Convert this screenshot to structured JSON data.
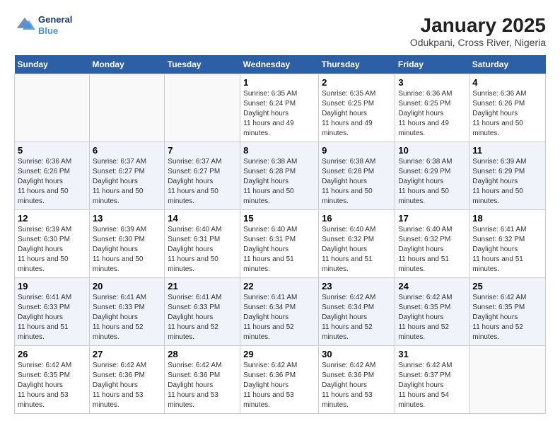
{
  "header": {
    "title": "January 2025",
    "subtitle": "Odukpani, Cross River, Nigeria",
    "logo_line1": "General",
    "logo_line2": "Blue"
  },
  "weekdays": [
    "Sunday",
    "Monday",
    "Tuesday",
    "Wednesday",
    "Thursday",
    "Friday",
    "Saturday"
  ],
  "weeks": [
    [
      {
        "day": "",
        "sunrise": "",
        "sunset": "",
        "daylight": ""
      },
      {
        "day": "",
        "sunrise": "",
        "sunset": "",
        "daylight": ""
      },
      {
        "day": "",
        "sunrise": "",
        "sunset": "",
        "daylight": ""
      },
      {
        "day": "1",
        "sunrise": "6:35 AM",
        "sunset": "6:24 PM",
        "daylight": "11 hours and 49 minutes."
      },
      {
        "day": "2",
        "sunrise": "6:35 AM",
        "sunset": "6:25 PM",
        "daylight": "11 hours and 49 minutes."
      },
      {
        "day": "3",
        "sunrise": "6:36 AM",
        "sunset": "6:25 PM",
        "daylight": "11 hours and 49 minutes."
      },
      {
        "day": "4",
        "sunrise": "6:36 AM",
        "sunset": "6:26 PM",
        "daylight": "11 hours and 50 minutes."
      }
    ],
    [
      {
        "day": "5",
        "sunrise": "6:36 AM",
        "sunset": "6:26 PM",
        "daylight": "11 hours and 50 minutes."
      },
      {
        "day": "6",
        "sunrise": "6:37 AM",
        "sunset": "6:27 PM",
        "daylight": "11 hours and 50 minutes."
      },
      {
        "day": "7",
        "sunrise": "6:37 AM",
        "sunset": "6:27 PM",
        "daylight": "11 hours and 50 minutes."
      },
      {
        "day": "8",
        "sunrise": "6:38 AM",
        "sunset": "6:28 PM",
        "daylight": "11 hours and 50 minutes."
      },
      {
        "day": "9",
        "sunrise": "6:38 AM",
        "sunset": "6:28 PM",
        "daylight": "11 hours and 50 minutes."
      },
      {
        "day": "10",
        "sunrise": "6:38 AM",
        "sunset": "6:29 PM",
        "daylight": "11 hours and 50 minutes."
      },
      {
        "day": "11",
        "sunrise": "6:39 AM",
        "sunset": "6:29 PM",
        "daylight": "11 hours and 50 minutes."
      }
    ],
    [
      {
        "day": "12",
        "sunrise": "6:39 AM",
        "sunset": "6:30 PM",
        "daylight": "11 hours and 50 minutes."
      },
      {
        "day": "13",
        "sunrise": "6:39 AM",
        "sunset": "6:30 PM",
        "daylight": "11 hours and 50 minutes."
      },
      {
        "day": "14",
        "sunrise": "6:40 AM",
        "sunset": "6:31 PM",
        "daylight": "11 hours and 50 minutes."
      },
      {
        "day": "15",
        "sunrise": "6:40 AM",
        "sunset": "6:31 PM",
        "daylight": "11 hours and 51 minutes."
      },
      {
        "day": "16",
        "sunrise": "6:40 AM",
        "sunset": "6:32 PM",
        "daylight": "11 hours and 51 minutes."
      },
      {
        "day": "17",
        "sunrise": "6:40 AM",
        "sunset": "6:32 PM",
        "daylight": "11 hours and 51 minutes."
      },
      {
        "day": "18",
        "sunrise": "6:41 AM",
        "sunset": "6:32 PM",
        "daylight": "11 hours and 51 minutes."
      }
    ],
    [
      {
        "day": "19",
        "sunrise": "6:41 AM",
        "sunset": "6:33 PM",
        "daylight": "11 hours and 51 minutes."
      },
      {
        "day": "20",
        "sunrise": "6:41 AM",
        "sunset": "6:33 PM",
        "daylight": "11 hours and 52 minutes."
      },
      {
        "day": "21",
        "sunrise": "6:41 AM",
        "sunset": "6:33 PM",
        "daylight": "11 hours and 52 minutes."
      },
      {
        "day": "22",
        "sunrise": "6:41 AM",
        "sunset": "6:34 PM",
        "daylight": "11 hours and 52 minutes."
      },
      {
        "day": "23",
        "sunrise": "6:42 AM",
        "sunset": "6:34 PM",
        "daylight": "11 hours and 52 minutes."
      },
      {
        "day": "24",
        "sunrise": "6:42 AM",
        "sunset": "6:35 PM",
        "daylight": "11 hours and 52 minutes."
      },
      {
        "day": "25",
        "sunrise": "6:42 AM",
        "sunset": "6:35 PM",
        "daylight": "11 hours and 52 minutes."
      }
    ],
    [
      {
        "day": "26",
        "sunrise": "6:42 AM",
        "sunset": "6:35 PM",
        "daylight": "11 hours and 53 minutes."
      },
      {
        "day": "27",
        "sunrise": "6:42 AM",
        "sunset": "6:36 PM",
        "daylight": "11 hours and 53 minutes."
      },
      {
        "day": "28",
        "sunrise": "6:42 AM",
        "sunset": "6:36 PM",
        "daylight": "11 hours and 53 minutes."
      },
      {
        "day": "29",
        "sunrise": "6:42 AM",
        "sunset": "6:36 PM",
        "daylight": "11 hours and 53 minutes."
      },
      {
        "day": "30",
        "sunrise": "6:42 AM",
        "sunset": "6:36 PM",
        "daylight": "11 hours and 53 minutes."
      },
      {
        "day": "31",
        "sunrise": "6:42 AM",
        "sunset": "6:37 PM",
        "daylight": "11 hours and 54 minutes."
      },
      {
        "day": "",
        "sunrise": "",
        "sunset": "",
        "daylight": ""
      }
    ]
  ]
}
